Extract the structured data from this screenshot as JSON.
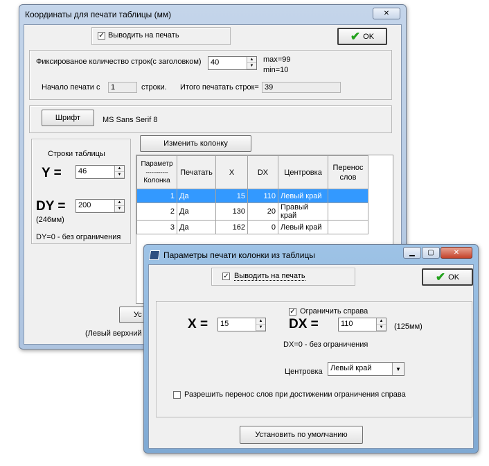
{
  "main": {
    "title": "Координаты для печати таблицы (мм)",
    "print_label": "Выводить на печать",
    "print_checked": true,
    "ok_label": "OK",
    "fixed_rows_label": "Фиксированое количество строк(с заголовком)",
    "fixed_rows_value": "40",
    "max_label": "max=99",
    "min_label": "min=10",
    "start_label": "Начало печати  с",
    "start_value": "1",
    "rows_suffix": "строки.",
    "total_label": "Итого печатать строк=",
    "total_value": "39",
    "font_button": "Шрифт",
    "font_name": "MS Sans Serif 8",
    "rows_group_title": "Строки таблицы",
    "y_label": "Y =",
    "y_value": "46",
    "dy_label": "DY =",
    "dy_value": "200",
    "dy_mm": "(246мм)",
    "dy_note": "DY=0 -  без  ограничения",
    "change_col_button": "Изменить колонку",
    "partial_button": "Ус",
    "partial_status": "(Левый верхний"
  },
  "table": {
    "headers": {
      "param_top": "Параметр",
      "param_sep": "------------",
      "param_bottom": "Колонка",
      "print": "Печатать",
      "x": "X",
      "dx": "DX",
      "center": "Центровка",
      "wrap_top": "Перенос",
      "wrap_bottom": "слов"
    },
    "rows": [
      {
        "n": "1",
        "print": "Да",
        "x": "15",
        "dx": "110",
        "center": "Левый край",
        "wrap": ""
      },
      {
        "n": "2",
        "print": "Да",
        "x": "130",
        "dx": "20",
        "center": "Правый край",
        "wrap": ""
      },
      {
        "n": "3",
        "print": "Да",
        "x": "162",
        "dx": "0",
        "center": "Левый край",
        "wrap": ""
      }
    ]
  },
  "dialog": {
    "title": "Параметры печати колонки из таблицы",
    "print_label": "Выводить на печать",
    "print_checked": true,
    "ok_label": "OK",
    "limit_right_label": "Ограничить справа",
    "limit_right_checked": true,
    "x_label": "X =",
    "x_value": "15",
    "dx_label": "DX =",
    "dx_value": "110",
    "dx_mm": "(125мм)",
    "dx_note": "DX=0  -  без  ограничения",
    "center_label": "Центровка",
    "center_value": "Левый край",
    "wrap_label": "Разрешить перенос слов при достижении  ограничения справа",
    "wrap_checked": false,
    "default_button": "Установить по умолчанию"
  },
  "colors": {
    "selection": "#3399ff",
    "ok_check": "#22a11c"
  }
}
